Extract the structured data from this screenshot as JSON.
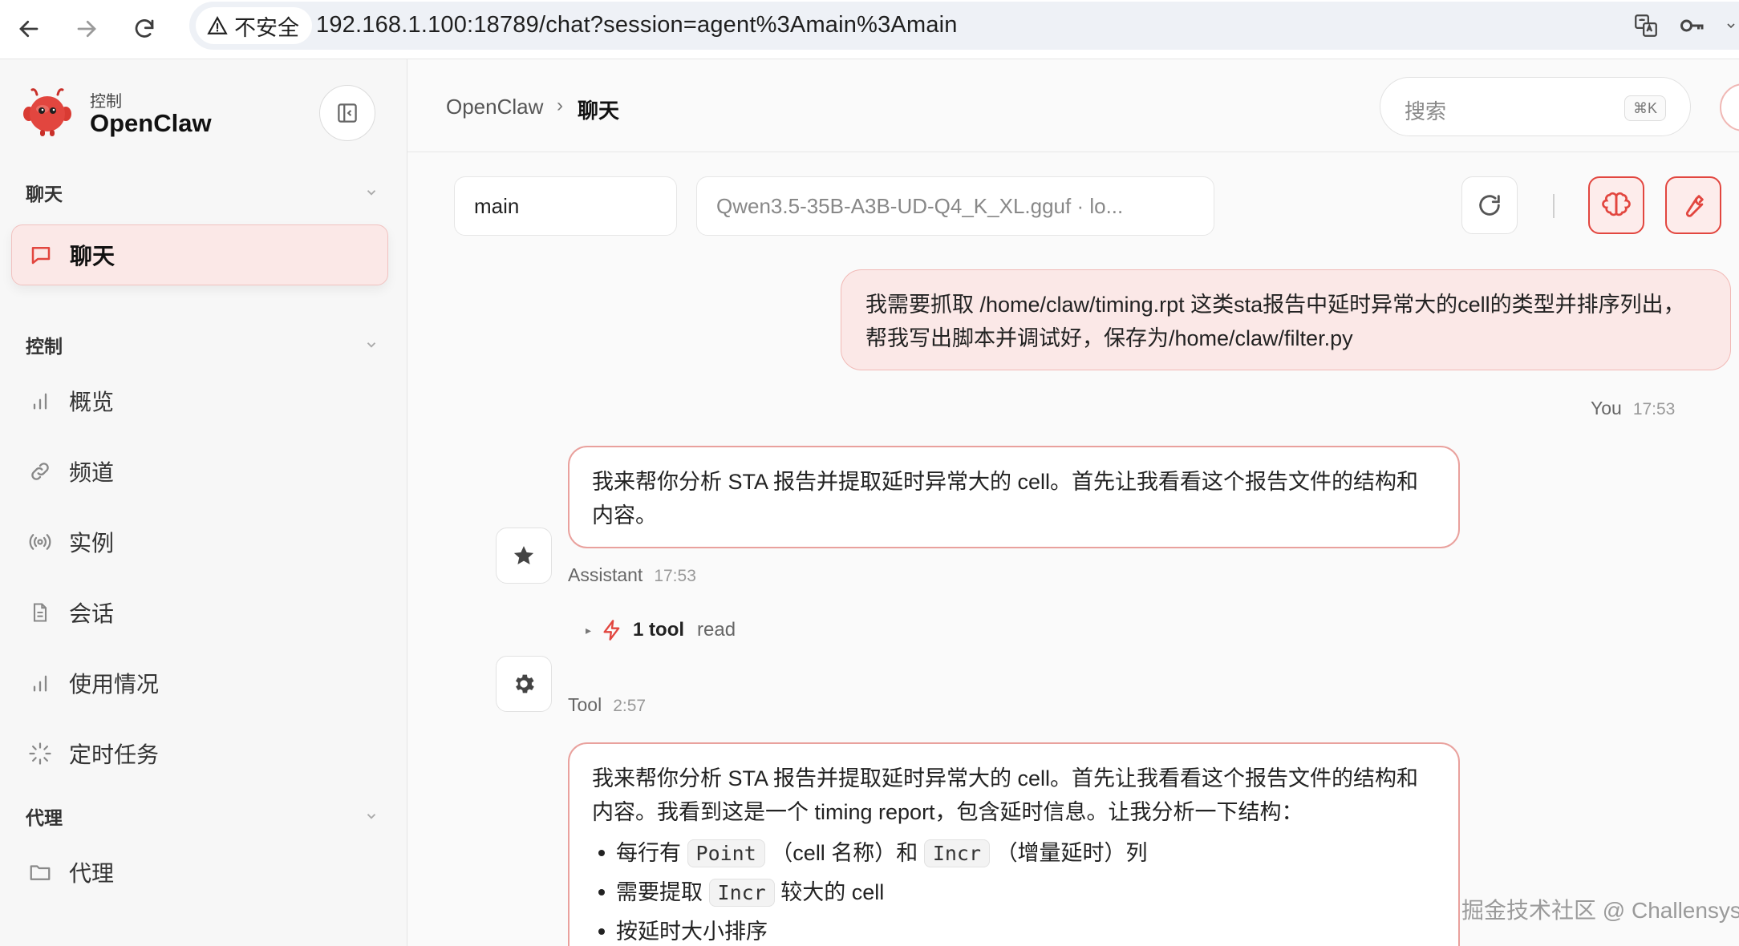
{
  "browser": {
    "security_label": "不安全",
    "url": "192.168.1.100:18789/chat?session=agent%3Amain%3Amain"
  },
  "sidebar": {
    "brand_subtitle": "控制",
    "brand_name": "OpenClaw",
    "sections": [
      {
        "label": "聊天",
        "items": [
          {
            "label": "聊天",
            "icon": "chat-bubble-icon",
            "active": true
          }
        ]
      },
      {
        "label": "控制",
        "items": [
          {
            "label": "概览",
            "icon": "bar-chart-icon"
          },
          {
            "label": "频道",
            "icon": "link-icon"
          },
          {
            "label": "实例",
            "icon": "radio-signal-icon"
          },
          {
            "label": "会话",
            "icon": "document-icon"
          },
          {
            "label": "使用情况",
            "icon": "bar-chart-icon"
          },
          {
            "label": "定时任务",
            "icon": "loader-icon"
          }
        ]
      },
      {
        "label": "代理",
        "items": [
          {
            "label": "代理",
            "icon": "folder-icon"
          }
        ]
      }
    ]
  },
  "header": {
    "breadcrumb_root": "OpenClaw",
    "breadcrumb_sep": "›",
    "breadcrumb_current": "聊天",
    "search_placeholder": "搜索",
    "search_shortcut": "⌘K"
  },
  "controls": {
    "session_value": "main",
    "model_value": "Qwen3.5-35B-A3B-UD-Q4_K_XL.gguf · lo..."
  },
  "messages": {
    "user": {
      "text": "我需要抓取 /home/claw/timing.rpt 这类sta报告中延时异常大的cell的类型并排序列出，帮我写出脚本并调试好，保存为/home/claw/filter.py",
      "author": "You",
      "time": "17:53"
    },
    "assistant": {
      "text": "我来帮你分析 STA 报告并提取延时异常大的 cell。首先让我看看这个报告文件的结构和内容。",
      "author": "Assistant",
      "time": "17:53"
    },
    "tool_call": {
      "count_label": "1 tool",
      "tool_name": "read"
    },
    "tool": {
      "author": "Tool",
      "time": "2:57"
    },
    "assistant2": {
      "intro": "我来帮你分析 STA 报告并提取延时异常大的 cell。首先让我看看这个报告文件的结构和内容。我看到这是一个 timing report，包含延时信息。让我分析一下结构：",
      "b1_pre": "每行有",
      "b1_code1": "Point",
      "b1_mid": "（cell 名称）和",
      "b1_code2": "Incr",
      "b1_post": "（增量延时）列",
      "b2_pre": "需要提取",
      "b2_code": "Incr",
      "b2_post": "较大的 cell",
      "b3": "按延时大小排序"
    }
  },
  "watermark": "掘金技术社区 @ Challensys",
  "colors": {
    "accent": "#e2463f",
    "accent_soft": "#fbe8e7"
  }
}
